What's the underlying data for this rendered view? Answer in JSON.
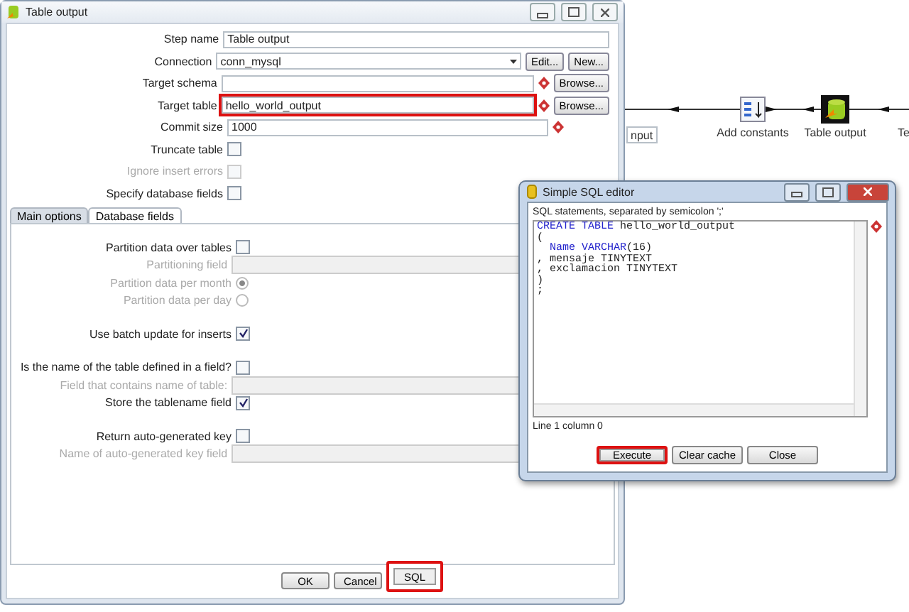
{
  "canvas": {
    "steps": [
      {
        "label": "nput",
        "kind": "input"
      },
      {
        "label": "Add constants",
        "kind": "constants"
      },
      {
        "label": "Table output",
        "kind": "output"
      },
      {
        "label": "Te",
        "kind": "cut"
      }
    ]
  },
  "dialog": {
    "title": "Table output",
    "fields": [
      {
        "kind": "text",
        "label": "Step name",
        "value": "Table output",
        "variable": false,
        "highlighted": false
      },
      {
        "kind": "combo",
        "label": "Connection",
        "value": "conn_mysql",
        "variable": false,
        "highlighted": false,
        "buttons": [
          "Edit...",
          "New..."
        ]
      },
      {
        "kind": "text",
        "label": "Target schema",
        "variable": true,
        "highlighted": false,
        "buttons": [
          "Browse..."
        ]
      },
      {
        "kind": "text",
        "label": "Target table",
        "value": "hello_world_output",
        "variable": true,
        "highlighted": true,
        "buttons": [
          "Browse..."
        ]
      },
      {
        "kind": "text",
        "label": "Commit size",
        "value": "1000",
        "variable": true,
        "highlighted": false
      },
      {
        "kind": "check",
        "label": "Truncate table",
        "checked": false,
        "disabled": false
      },
      {
        "kind": "check",
        "label": "Ignore insert errors",
        "checked": false,
        "disabled": true
      },
      {
        "kind": "check",
        "label": "Specify database fields",
        "checked": false,
        "disabled": false
      }
    ],
    "tabs": [
      {
        "label": "Main options",
        "selected": true
      },
      {
        "label": "Database fields",
        "selected": false
      }
    ],
    "groups": [
      {
        "options": [
          {
            "kind": "check",
            "label": "Partition data over tables",
            "checked": false,
            "disabled": false
          },
          {
            "kind": "field",
            "label": "Partitioning field",
            "disabled": true
          },
          {
            "kind": "radio",
            "label": "Partition data per month",
            "selected": true,
            "disabled": true
          },
          {
            "kind": "radio",
            "label": "Partition data per day",
            "selected": false,
            "disabled": true
          }
        ]
      },
      {
        "options": [
          {
            "kind": "check",
            "label": "Use batch update for inserts",
            "checked": true,
            "disabled": false
          }
        ]
      },
      {
        "options": [
          {
            "kind": "check",
            "label": "Is the name of the table defined in a field?",
            "checked": false,
            "disabled": false
          },
          {
            "kind": "field",
            "label": "Field that contains name of table:",
            "disabled": true
          },
          {
            "kind": "check",
            "label": "Store the tablename field",
            "checked": true,
            "disabled": false
          }
        ]
      },
      {
        "options": [
          {
            "kind": "check",
            "label": "Return auto-generated key",
            "checked": false,
            "disabled": false
          },
          {
            "kind": "field",
            "label": "Name of auto-generated key field",
            "disabled": true
          }
        ]
      }
    ],
    "buttons": [
      {
        "label": "OK",
        "highlighted": false
      },
      {
        "label": "Cancel",
        "highlighted": false
      },
      {
        "label": "SQL",
        "highlighted": true
      }
    ]
  },
  "sql_editor": {
    "title": "Simple SQL editor",
    "hint": "SQL statements, separated by semicolon ';'",
    "lines": [
      [
        {
          "text": "CREATE TABLE",
          "kind": "keyword"
        },
        {
          "text": " hello_world_output",
          "kind": "plain"
        }
      ],
      [
        {
          "text": "(",
          "kind": "plain"
        }
      ],
      [
        {
          "text": "  Name VARCHAR",
          "kind": "keyword"
        },
        {
          "text": "(16)",
          "kind": "plain"
        }
      ],
      [
        {
          "text": ", mensaje TINYTEXT",
          "kind": "plain"
        }
      ],
      [
        {
          "text": ", exclamacion TINYTEXT",
          "kind": "plain"
        }
      ],
      [
        {
          "text": ")",
          "kind": "plain"
        }
      ],
      [
        {
          "text": ";",
          "kind": "plain"
        }
      ]
    ],
    "status": "Line 1 column 0",
    "buttons": [
      {
        "label": "Execute",
        "highlighted": true
      },
      {
        "label": "Clear cache",
        "highlighted": false
      },
      {
        "label": "Close",
        "highlighted": false
      }
    ]
  }
}
